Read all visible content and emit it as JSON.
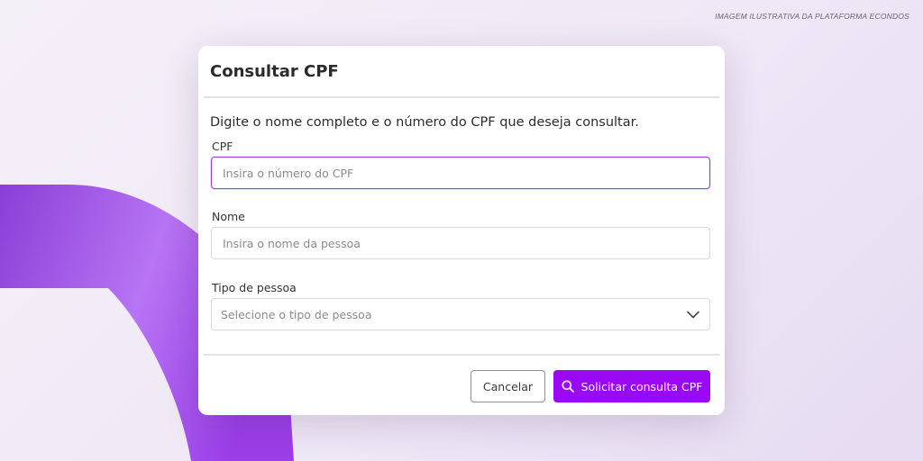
{
  "caption": "IMAGEM ILUSTRATIVA DA PLATAFORMA ECONDOS",
  "modal": {
    "title": "Consultar CPF",
    "intro": "Digite o nome completo e o número do CPF que deseja consultar.",
    "fields": {
      "cpf": {
        "label": "CPF",
        "placeholder": "Insira o número do CPF",
        "value": ""
      },
      "nome": {
        "label": "Nome",
        "placeholder": "Insira o nome da pessoa",
        "value": ""
      },
      "tipo": {
        "label": "Tipo de pessoa",
        "placeholder": "Selecione o tipo de pessoa"
      }
    },
    "buttons": {
      "cancel": "Cancelar",
      "submit": "Solicitar consulta CPF"
    }
  },
  "colors": {
    "accent": "#9b09f4",
    "focus_border": "#9a3fe0",
    "decoration_dark": "#8a3fd6",
    "decoration_light": "#b774f3"
  },
  "icons": {
    "submit": "search-icon",
    "select": "chevron-down-icon"
  }
}
